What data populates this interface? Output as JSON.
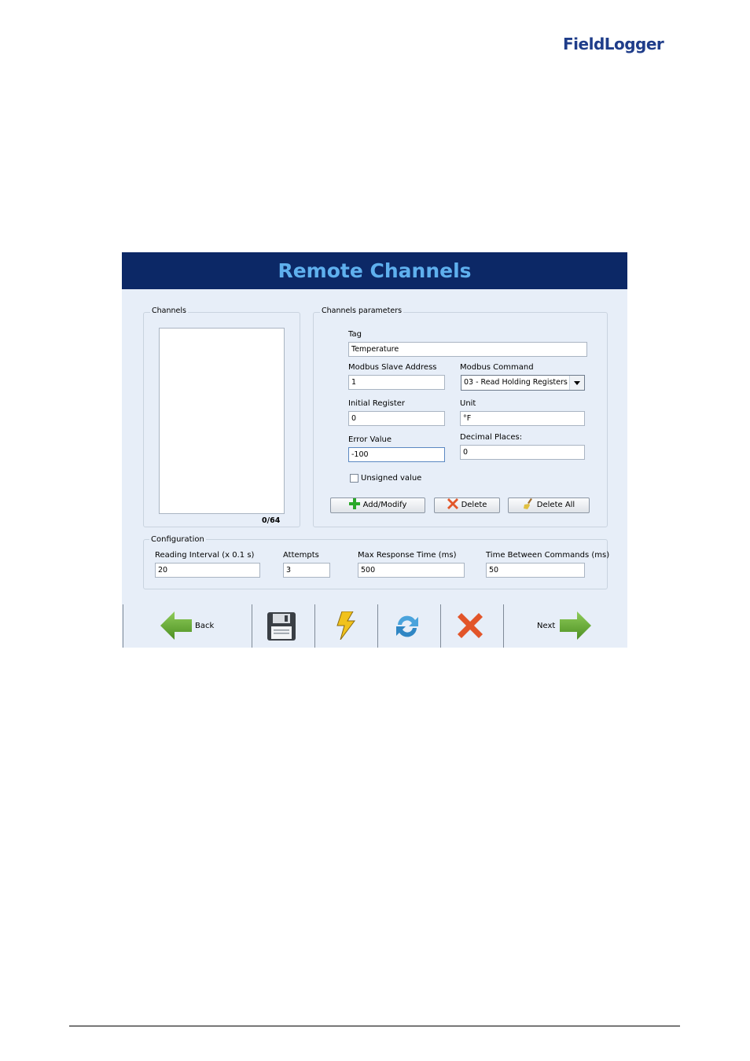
{
  "header": {
    "title": "Remote Channels"
  },
  "channels": {
    "group_label": "Channels",
    "count": "0/64"
  },
  "params": {
    "group_label": "Channels parameters",
    "tag_label": "Tag",
    "tag_value": "Temperature",
    "slave_label": "Modbus Slave Address",
    "slave_value": "1",
    "command_label": "Modbus Command",
    "command_value": "03 - Read Holding Registers",
    "initial_label": "Initial Register",
    "initial_value": "0",
    "unit_label": "Unit",
    "unit_value": "°F",
    "error_label": "Error Value",
    "error_value": "-100",
    "decimal_label": "Decimal Places:",
    "decimal_value": "0",
    "unsigned_label": "Unsigned value",
    "unsigned_checked": false
  },
  "buttons": {
    "add_modify": "Add/Modify",
    "delete": "Delete",
    "delete_all": "Delete All"
  },
  "config": {
    "group_label": "Configuration",
    "interval_label": "Reading Interval (x 0.1 s)",
    "interval_value": "20",
    "attempts_label": "Attempts",
    "attempts_value": "3",
    "max_resp_label": "Max Response Time (ms)",
    "max_resp_value": "500",
    "between_label": "Time Between Commands (ms)",
    "between_value": "50"
  },
  "toolbar": {
    "back_label": "Back",
    "next_label": "Next",
    "icons": [
      "back-arrow-icon",
      "save-icon",
      "lightning-icon",
      "refresh-icon",
      "close-icon",
      "next-arrow-icon"
    ]
  },
  "colors": {
    "header_bg": "#0c2866",
    "header_text": "#5fb0ee",
    "panel_bg": "#e7eef8",
    "logo_blue": "#1f3d8a"
  }
}
